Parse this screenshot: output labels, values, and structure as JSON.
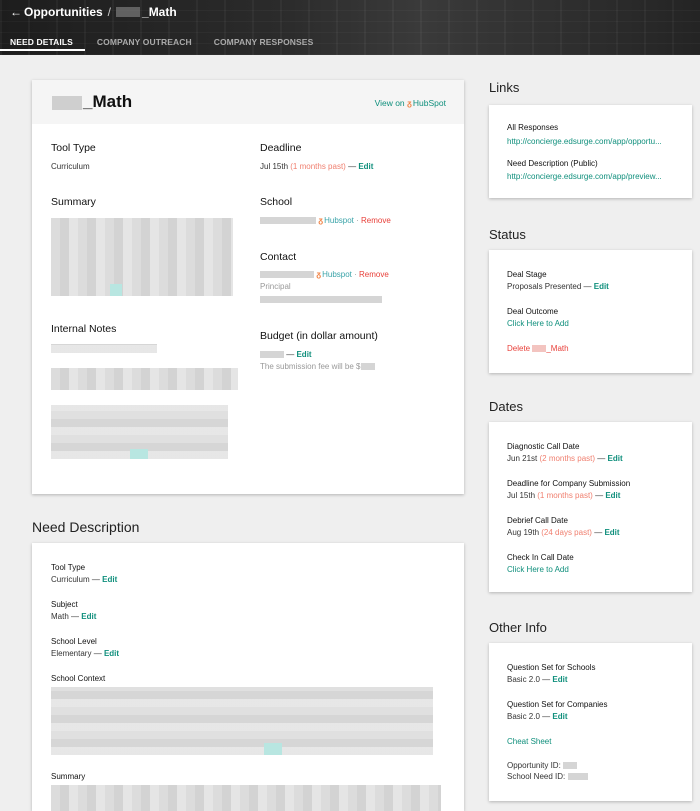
{
  "header": {
    "back_icon": "←",
    "breadcrumb_root": "Opportunities",
    "breadcrumb_sep": "/",
    "breadcrumb_current": "_Math",
    "tabs": [
      "NEED DETAILS",
      "COMPANY OUTREACH",
      "COMPANY RESPONSES"
    ]
  },
  "main": {
    "title": "_Math",
    "view_on": "View on",
    "hubspot": "HubSpot",
    "tool_type_label": "Tool Type",
    "tool_type_value": "Curriculum",
    "deadline_label": "Deadline",
    "deadline_date": "Jul 15th",
    "deadline_past": "(1 months past)",
    "dash": "—",
    "edit": "Edit",
    "summary_label": "Summary",
    "school_label": "School",
    "hubspot_small": "Hubspot",
    "remove": "Remove",
    "contact_label": "Contact",
    "contact_role": "Principal",
    "internal_notes_label": "Internal Notes",
    "budget_label": "Budget (in dollar amount)",
    "budget_fee": "The submission fee will be $"
  },
  "need_description": {
    "heading": "Need Description",
    "tool_type_label": "Tool Type",
    "tool_type_value": "Curriculum",
    "subject_label": "Subject",
    "subject_value": "Math",
    "school_level_label": "School Level",
    "school_level_value": "Elementary",
    "school_context_label": "School Context",
    "summary_label": "Summary"
  },
  "links": {
    "heading": "Links",
    "all_responses_label": "All Responses",
    "all_responses_url": "http://concierge.edsurge.com/app/opportu...",
    "need_desc_label": "Need Description (Public)",
    "need_desc_url": "http://concierge.edsurge.com/app/preview..."
  },
  "status": {
    "heading": "Status",
    "deal_stage_label": "Deal Stage",
    "deal_stage_value": "Proposals Presented",
    "deal_outcome_label": "Deal Outcome",
    "deal_outcome_link": "Click Here to Add",
    "delete_label": "Delete",
    "delete_suffix": "_Math"
  },
  "dates": {
    "heading": "Dates",
    "diag_label": "Diagnostic Call Date",
    "diag_date": "Jun 21st",
    "diag_past": "(2 months past)",
    "deadline_label": "Deadline for Company Submission",
    "deadline_date": "Jul 15th",
    "deadline_past": "(1 months past)",
    "debrief_label": "Debrief Call Date",
    "debrief_date": "Aug 19th",
    "debrief_past": "(24 days past)",
    "checkin_label": "Check In Call Date",
    "checkin_link": "Click Here to Add"
  },
  "other": {
    "heading": "Other Info",
    "qs_schools_label": "Question Set for Schools",
    "qs_schools_value": "Basic 2.0",
    "qs_companies_label": "Question Set for Companies",
    "qs_companies_value": "Basic 2.0",
    "cheat_sheet": "Cheat Sheet",
    "opp_id_label": "Opportunity ID:",
    "need_id_label": "School Need ID:"
  },
  "colors": {
    "accent": "#0f8f7c",
    "past": "#f07f6f",
    "danger": "#e8403a"
  }
}
